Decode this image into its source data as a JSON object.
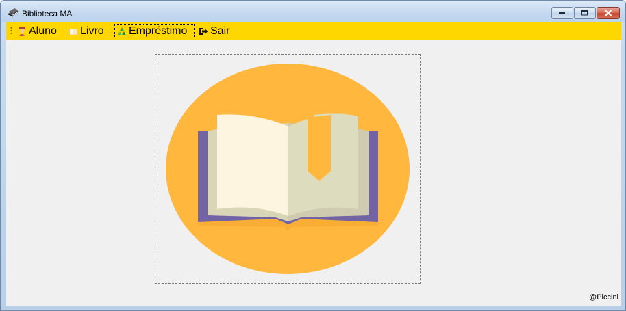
{
  "window": {
    "title": "Biblioteca MA",
    "minimize_icon": "minimize-icon",
    "maximize_icon": "maximize-icon",
    "close_icon": "close-icon"
  },
  "menu": {
    "items": [
      {
        "label": "Aluno",
        "icon": "student-icon"
      },
      {
        "label": "Livro",
        "icon": "book-icon"
      },
      {
        "label": "Empréstimo",
        "icon": "recycle-icon",
        "selected": true
      },
      {
        "label": "Sair",
        "icon": "exit-icon"
      }
    ],
    "background": "#ffd700"
  },
  "main": {
    "image": "book-logo",
    "credit": "@Piccini"
  },
  "colors": {
    "circle": "#ffb83d",
    "book_cover": "#7264a4",
    "page_left": "#fef5e0",
    "page_right": "#dedcbf",
    "client_bg": "#f0f0f0"
  }
}
